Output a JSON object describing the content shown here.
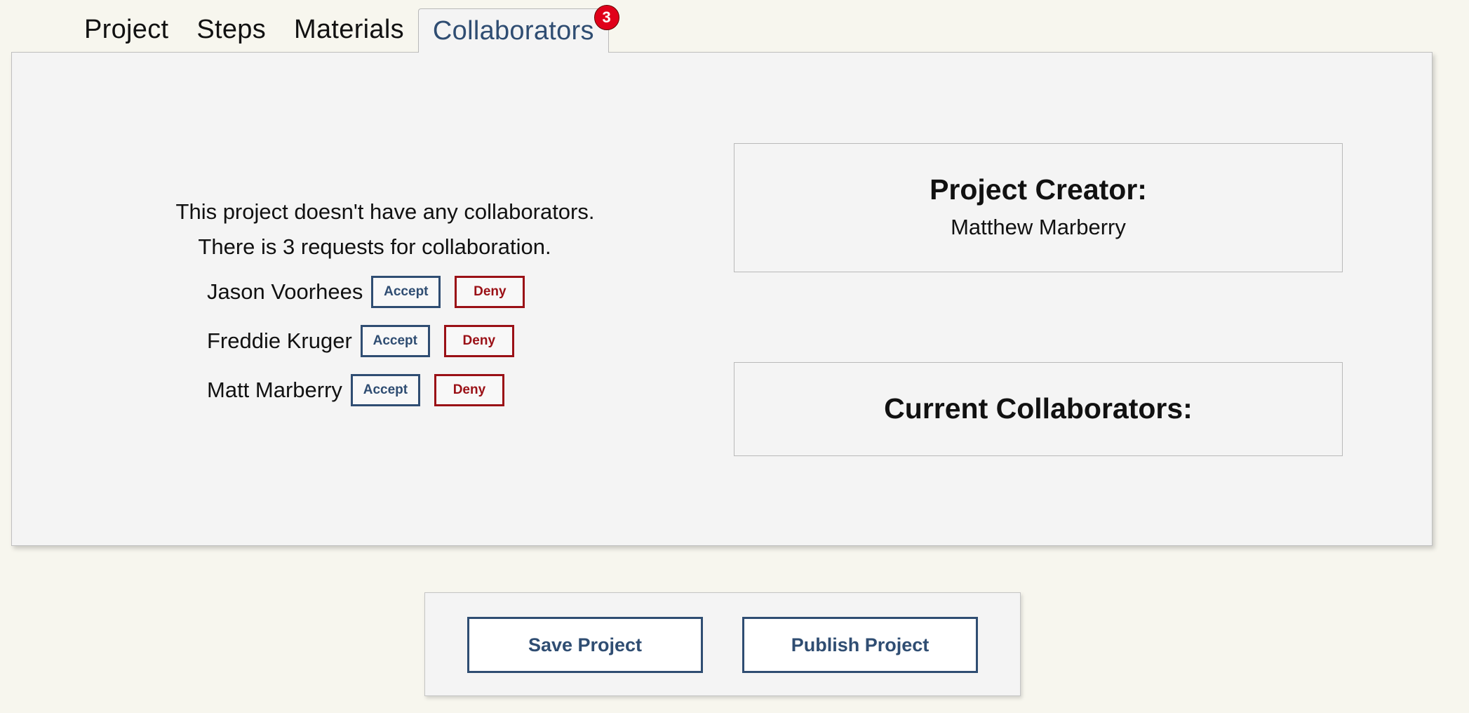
{
  "tabs": [
    {
      "label": "Project"
    },
    {
      "label": "Steps"
    },
    {
      "label": "Materials"
    },
    {
      "label": "Collaborators",
      "badge": "3",
      "active": true
    }
  ],
  "collaborators_panel": {
    "no_collaborators_msg": "This project doesn't have any collaborators.",
    "requests_msg": "There is 3 requests for collaboration.",
    "requests": [
      {
        "name": "Jason Voorhees",
        "accept_label": "Accept",
        "deny_label": "Deny"
      },
      {
        "name": "Freddie Kruger",
        "accept_label": "Accept",
        "deny_label": "Deny"
      },
      {
        "name": "Matt Marberry",
        "accept_label": "Accept",
        "deny_label": "Deny"
      }
    ],
    "creator_heading": "Project Creator:",
    "creator_name": "Matthew Marberry",
    "current_collaborators_heading": "Current Collaborators:"
  },
  "footer": {
    "save_label": "Save Project",
    "publish_label": "Publish Project"
  },
  "colors": {
    "page_bg": "#f7f6ee",
    "panel_bg": "#f4f4f4",
    "accent_blue": "#2f4d72",
    "deny_red": "#9a1016",
    "badge_red": "#e0001a"
  }
}
